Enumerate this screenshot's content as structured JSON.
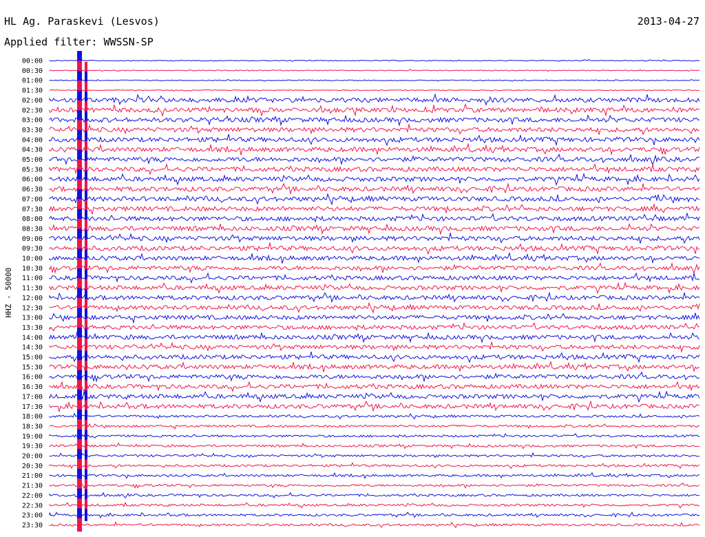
{
  "header": {
    "station": "HL Ag. Paraskevi (Lesvos)",
    "filter": "Applied filter: WWSSN-SP",
    "date": "2013-04-27"
  },
  "colors": {
    "trace_a": "#1010e0",
    "trace_b": "#f0144a",
    "background": "#ffffff",
    "text": "#000000"
  },
  "chart_data": {
    "type": "helicorder",
    "title": "HL Ag. Paraskevi (Lesvos)",
    "subtitle": "Applied filter: WWSSN-SP",
    "ylabel": "HHZ - 50000",
    "date": "2013-04-27",
    "ytick_labels": [
      "00:00",
      "00:30",
      "01:00",
      "01:30",
      "02:00",
      "02:30",
      "03:00",
      "03:30",
      "04:00",
      "04:30",
      "05:00",
      "05:30",
      "06:00",
      "06:30",
      "07:00",
      "07:30",
      "08:00",
      "08:30",
      "09:00",
      "09:30",
      "10:00",
      "10:30",
      "11:00",
      "11:30",
      "12:00",
      "12:30",
      "13:00",
      "13:30",
      "14:00",
      "14:30",
      "15:00",
      "15:30",
      "16:00",
      "16:30",
      "17:00",
      "17:30",
      "18:00",
      "18:30",
      "19:00",
      "19:30",
      "20:00",
      "20:30",
      "21:00",
      "21:30",
      "22:00",
      "22:30",
      "23:00",
      "23:30"
    ],
    "trace_colors": [
      "#1010e0",
      "#f0144a"
    ],
    "grid": false,
    "events": [
      {
        "row_from": 0,
        "row_to": 47,
        "x_frac": 0.205,
        "amplitude": 1.0,
        "label": ""
      },
      {
        "row_from": 1,
        "row_to": 46,
        "x_frac": 0.215,
        "amplitude": 0.9,
        "label": ""
      }
    ]
  }
}
